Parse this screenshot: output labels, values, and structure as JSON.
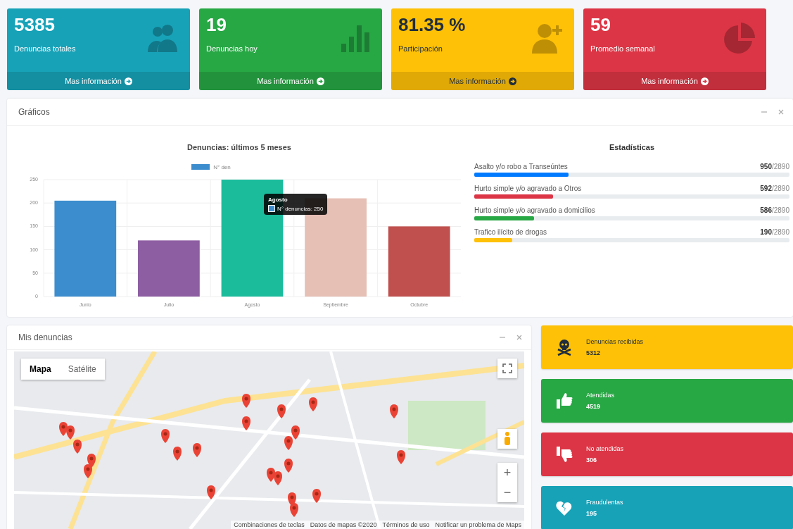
{
  "summary_cards": [
    {
      "value": "5385",
      "label": "Denuncias totales",
      "link": "Mas información",
      "color": "#17a2b8"
    },
    {
      "value": "19",
      "label": "Denuncias hoy",
      "link": "Mas información",
      "color": "#28a745"
    },
    {
      "value": "81.35 %",
      "label": "Participación",
      "link": "Mas información",
      "color": "#ffc107"
    },
    {
      "value": "59",
      "label": "Promedio semanal",
      "link": "Mas información",
      "color": "#dc3545"
    }
  ],
  "charts_panel": {
    "title": "Gráficos",
    "chart_data": {
      "type": "bar",
      "title": "Denuncias: últimos 5 meses",
      "categories": [
        "Junio",
        "Julio",
        "Agosto",
        "Septiembre",
        "Octubre"
      ],
      "series": [
        {
          "name": "N° den",
          "color": "#3c8dce",
          "colors": [
            "#3c8dce",
            "#8e5ea2",
            "#1abc9c",
            "#e6bfb5",
            "#c0504d"
          ],
          "values": [
            205,
            120,
            250,
            210,
            150
          ]
        }
      ],
      "ylim": [
        0,
        250
      ],
      "yticks": [
        0,
        50,
        100,
        150,
        200,
        250
      ],
      "grid": true
    },
    "tooltip": {
      "title": "Agosto",
      "body": "N° denuncias: 250"
    },
    "stats": {
      "title": "Estadísticas",
      "items": [
        {
          "label": "Asalto y/o robo a Transeúntes",
          "count": "950",
          "total": "/2890",
          "level": 0.3,
          "color": "#007bff"
        },
        {
          "label": "Hurto simple y/o agravado a Otros",
          "count": "592",
          "total": "/2890",
          "level": 0.25,
          "color": "#dc3545"
        },
        {
          "label": "Hurto simple y/o agravado a domicilios",
          "count": "586",
          "total": "/2890",
          "level": 0.19,
          "color": "#28a745"
        },
        {
          "label": "Trafico ilícito de drogas",
          "count": "190",
          "total": "/2890",
          "level": 0.12,
          "color": "#ffc107"
        }
      ]
    }
  },
  "map_panel": {
    "title": "Mis denuncias",
    "map_types": [
      {
        "label": "Mapa",
        "selected": true
      },
      {
        "label": "Satélite",
        "selected": false
      }
    ],
    "zoom_in": "+",
    "zoom_out": "−",
    "attribution": [
      "Combinaciones de teclas",
      "Datos de mapas ©2020",
      "Términos de uso",
      "Notificar un problema de Maps"
    ]
  },
  "info_boxes": [
    {
      "label": "Denuncias recibidas",
      "value": "5312",
      "color": "#ffc107"
    },
    {
      "label": "Atendidas",
      "value": "4519",
      "color": "#28a745"
    },
    {
      "label": "No atendidas",
      "value": "306",
      "color": "#dc3545"
    },
    {
      "label": "Fraudulentas",
      "value": "195",
      "color": "#17a2b8"
    }
  ]
}
